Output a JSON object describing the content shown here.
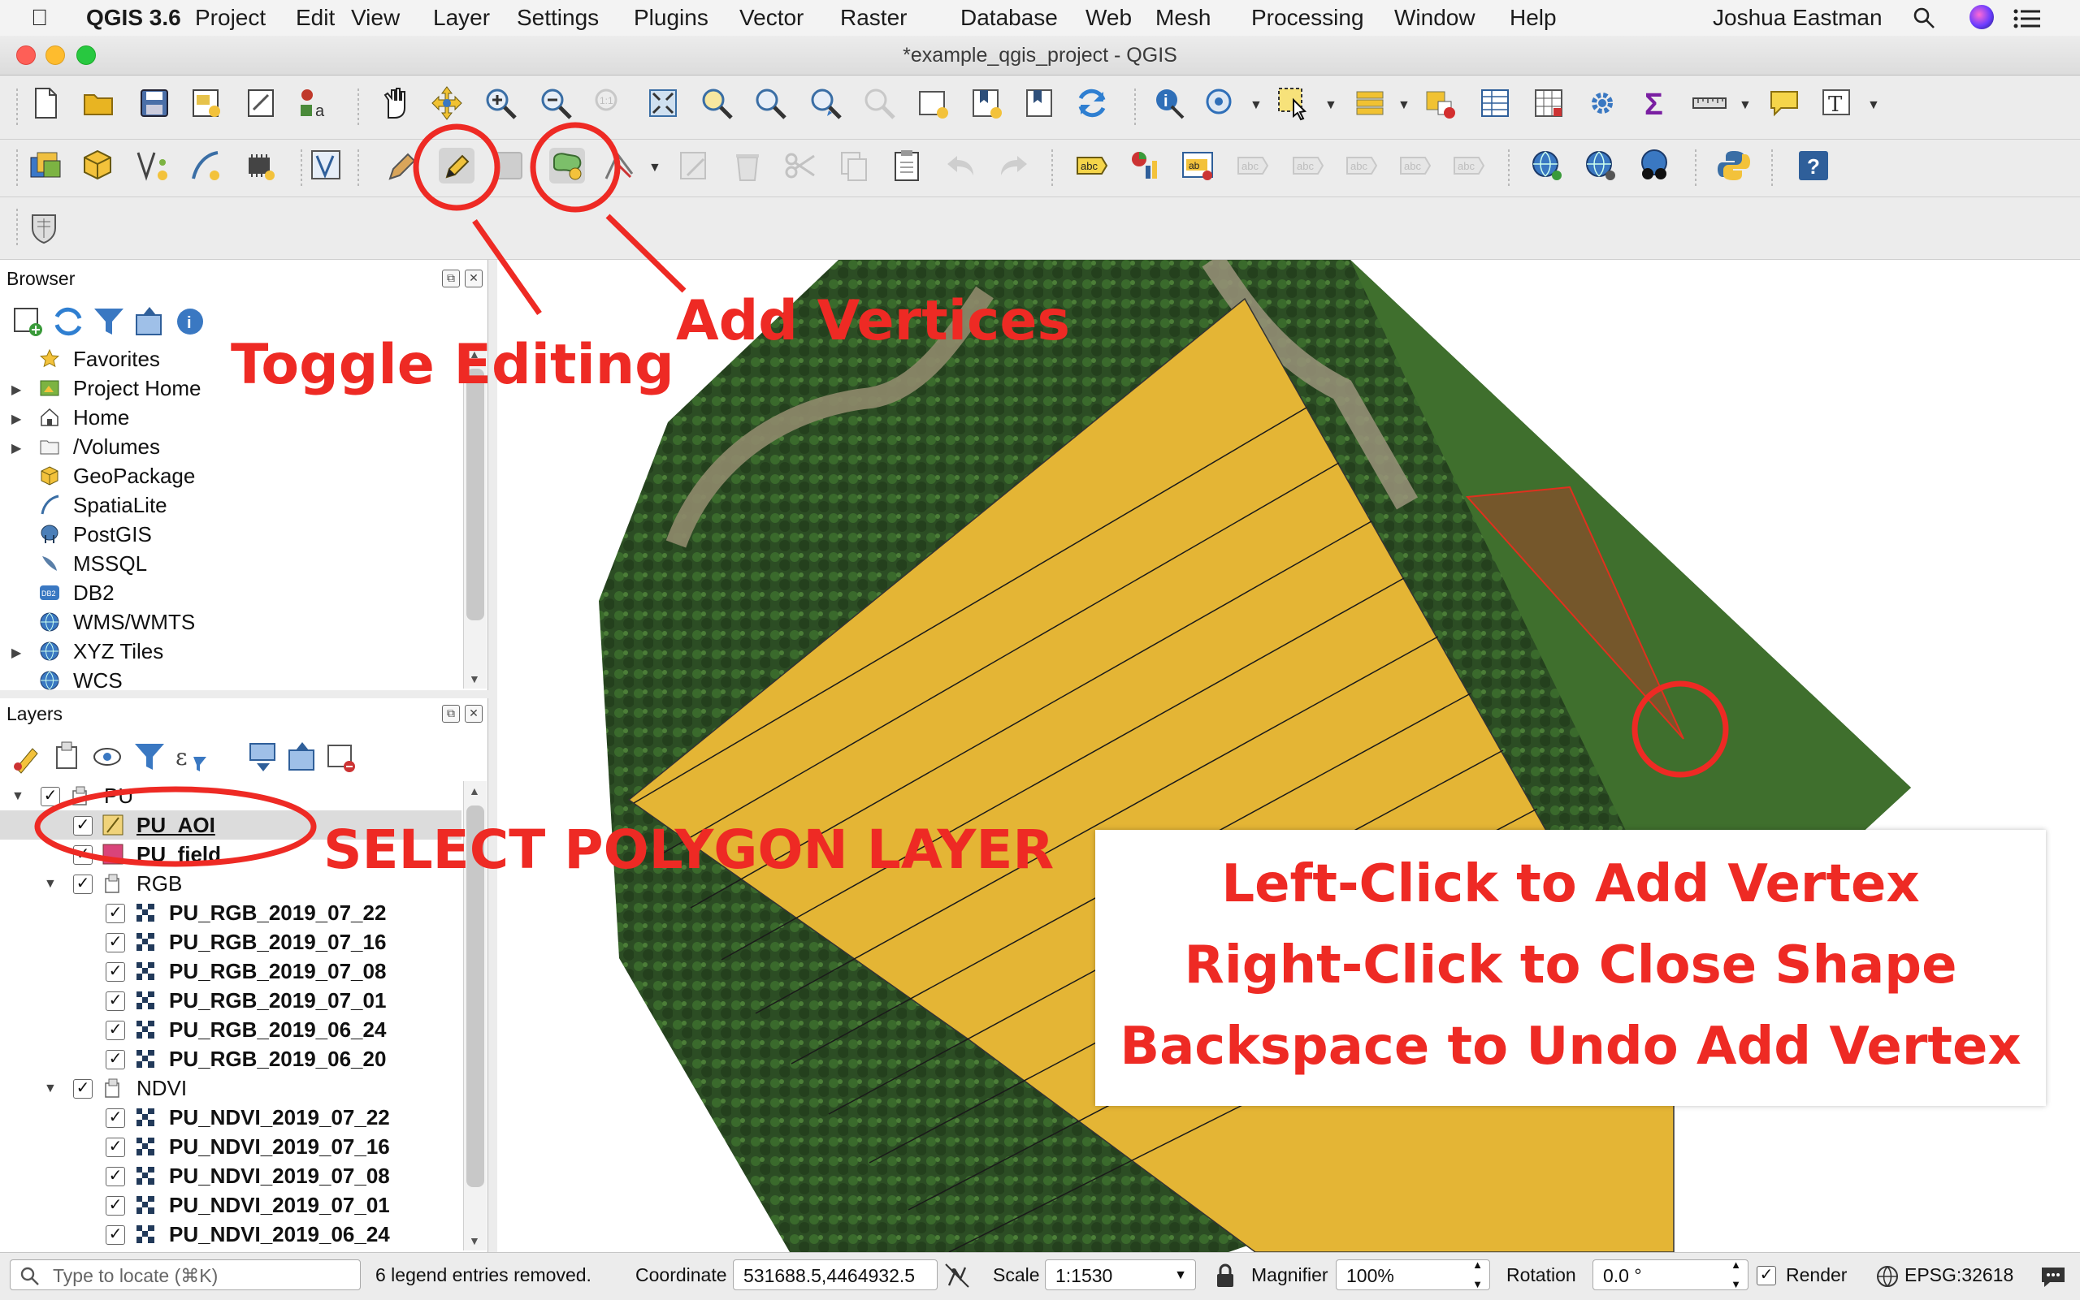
{
  "menubar": {
    "app": "QGIS 3.6",
    "items": [
      "Project",
      "Edit",
      "View",
      "Layer",
      "Settings",
      "Plugins",
      "Vector",
      "Raster",
      "Database",
      "Web",
      "Mesh",
      "Processing",
      "Window",
      "Help"
    ],
    "user": "Joshua Eastman"
  },
  "window": {
    "title": "*example_qgis_project - QGIS"
  },
  "browser": {
    "title": "Browser",
    "items": [
      {
        "label": "Favorites",
        "icon": "star-icon",
        "expandable": false
      },
      {
        "label": "Project Home",
        "icon": "project-home-icon",
        "expandable": true
      },
      {
        "label": "Home",
        "icon": "home-icon",
        "expandable": true
      },
      {
        "label": "/Volumes",
        "icon": "folder-icon",
        "expandable": true
      },
      {
        "label": "GeoPackage",
        "icon": "geopackage-icon",
        "expandable": false
      },
      {
        "label": "SpatiaLite",
        "icon": "spatialite-icon",
        "expandable": false
      },
      {
        "label": "PostGIS",
        "icon": "postgis-icon",
        "expandable": false
      },
      {
        "label": "MSSQL",
        "icon": "mssql-icon",
        "expandable": false
      },
      {
        "label": "DB2",
        "icon": "db2-icon",
        "expandable": false
      },
      {
        "label": "WMS/WMTS",
        "icon": "globe-icon",
        "expandable": false
      },
      {
        "label": "XYZ Tiles",
        "icon": "globe-icon",
        "expandable": true
      },
      {
        "label": "WCS",
        "icon": "globe-icon",
        "expandable": false
      }
    ]
  },
  "layers": {
    "title": "Layers",
    "items": [
      {
        "label": "PU",
        "kind": "group",
        "level": 0,
        "checked": true
      },
      {
        "label": "PU_AOI",
        "kind": "polygon-selected",
        "level": 1,
        "checked": true
      },
      {
        "label": "PU_field",
        "kind": "polygon",
        "level": 1,
        "checked": true
      },
      {
        "label": "RGB",
        "kind": "group",
        "level": 1,
        "checked": true
      },
      {
        "label": "PU_RGB_2019_07_22",
        "kind": "raster",
        "level": 2,
        "checked": true
      },
      {
        "label": "PU_RGB_2019_07_16",
        "kind": "raster",
        "level": 2,
        "checked": true
      },
      {
        "label": "PU_RGB_2019_07_08",
        "kind": "raster",
        "level": 2,
        "checked": true
      },
      {
        "label": "PU_RGB_2019_07_01",
        "kind": "raster",
        "level": 2,
        "checked": true
      },
      {
        "label": "PU_RGB_2019_06_24",
        "kind": "raster",
        "level": 2,
        "checked": true
      },
      {
        "label": "PU_RGB_2019_06_20",
        "kind": "raster",
        "level": 2,
        "checked": true
      },
      {
        "label": "NDVI",
        "kind": "group",
        "level": 1,
        "checked": true
      },
      {
        "label": "PU_NDVI_2019_07_22",
        "kind": "raster",
        "level": 2,
        "checked": true
      },
      {
        "label": "PU_NDVI_2019_07_16",
        "kind": "raster",
        "level": 2,
        "checked": true
      },
      {
        "label": "PU_NDVI_2019_07_08",
        "kind": "raster",
        "level": 2,
        "checked": true
      },
      {
        "label": "PU_NDVI_2019_07_01",
        "kind": "raster",
        "level": 2,
        "checked": true
      },
      {
        "label": "PU_NDVI_2019_06_24",
        "kind": "raster",
        "level": 2,
        "checked": true
      }
    ]
  },
  "annotations": {
    "toggle_editing": "Toggle Editing",
    "add_vertices": "Add Vertices",
    "select_layer": "SELECT POLYGON LAYER",
    "instructions": [
      "Left-Click to Add Vertex",
      "Right-Click to Close Shape",
      "Backspace to Undo Add Vertex"
    ]
  },
  "statusbar": {
    "locator_placeholder": "Type to locate (⌘K)",
    "message": "6 legend entries removed.",
    "coordinate_label": "Coordinate",
    "coordinate_value": "531688.5,4464932.5",
    "scale_label": "Scale",
    "scale_value": "1:1530",
    "magnifier_label": "Magnifier",
    "magnifier_value": "100%",
    "rotation_label": "Rotation",
    "rotation_value": "0.0 °",
    "render_label": "Render",
    "crs": "EPSG:32618"
  },
  "colors": {
    "annotation_red": "#ee2a24",
    "polygon_fill": "#e4b535",
    "pu_field_swatch": "#d9447a"
  }
}
